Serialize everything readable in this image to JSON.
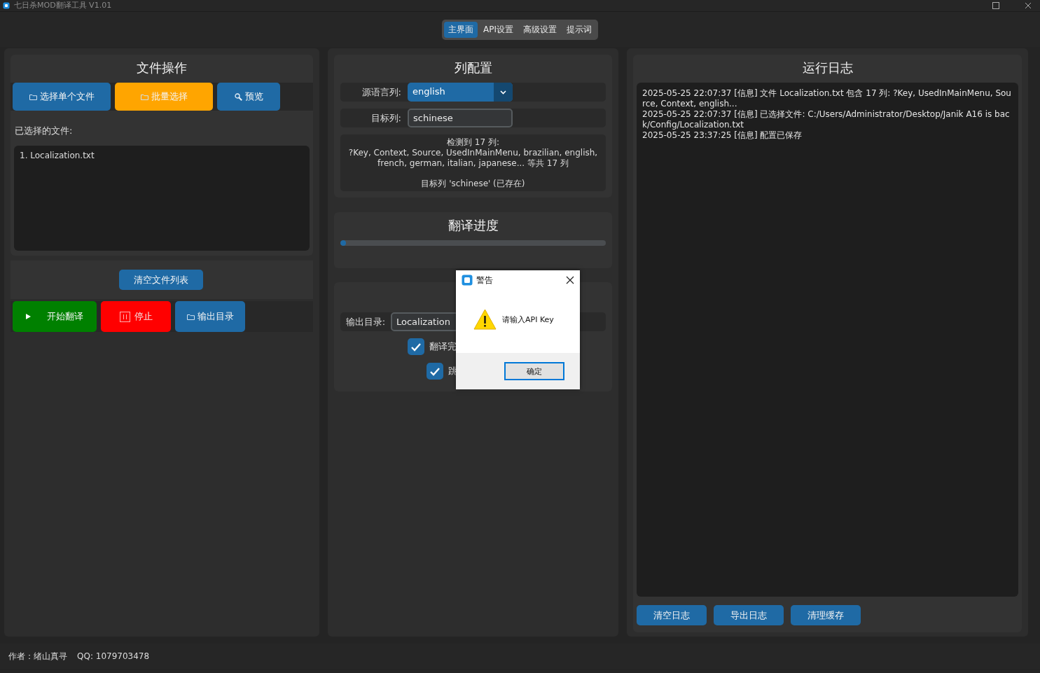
{
  "window": {
    "title": "七日杀MOD翻译工具 V1.01"
  },
  "tabs": [
    {
      "label": "主界面",
      "selected": true
    },
    {
      "label": "API设置",
      "selected": false
    },
    {
      "label": "高级设置",
      "selected": false
    },
    {
      "label": "提示词",
      "selected": false
    }
  ],
  "file_panel": {
    "title": "文件操作",
    "buttons": [
      {
        "label": "选择单个文件",
        "kind": "folder",
        "color": "#1f6aa5"
      },
      {
        "label": "批量选择",
        "kind": "folder",
        "color": "#ffa500"
      },
      {
        "label": "预览",
        "kind": "search",
        "color": "#1f6aa5"
      }
    ],
    "selected_label": "已选择的文件:",
    "files": [
      "1. Localization.txt"
    ],
    "clear_button": "清空文件列表",
    "actions": [
      {
        "label": "开始翻译",
        "kind": "play",
        "color": "#008000"
      },
      {
        "label": "停止",
        "kind": "pause",
        "color": "#ff0000"
      },
      {
        "label": "输出目录",
        "kind": "folder",
        "color": "#1f6aa5"
      }
    ]
  },
  "column_config": {
    "title": "列配置",
    "source": {
      "label": "源语言列:",
      "value": "english"
    },
    "target": {
      "label": "目标列:",
      "value": "schinese"
    },
    "detection": "检测到 17 列:\n?Key, Context, Source, UsedInMainMenu, brazilian, english,\nfrench, german, italian, japanese... 等共 17 列",
    "target_status": "目标列 'schinese' (已存在)"
  },
  "progress": {
    "title": "翻译进度",
    "level": 0.02
  },
  "output": {
    "dir_label": "输出目录:",
    "dir_value": "Localization",
    "options": [
      {
        "label": "翻译完",
        "checked": true
      },
      {
        "label": "跳",
        "checked": true
      }
    ]
  },
  "log": {
    "title": "运行日志",
    "entries": [
      "2025-05-25 22:07:37 [信息] 文件 Localization.txt 包含 17 列: ?Key, UsedInMainMenu, Source, Context, english...",
      "2025-05-25 22:07:37 [信息] 已选择文件: C:/Users/Administrator/Desktop/Janik A16 is back/Config/Localization.txt",
      "2025-05-25 23:37:25 [信息] 配置已保存"
    ],
    "buttons": [
      "清空日志",
      "导出日志",
      "清理缓存"
    ]
  },
  "status_bar": [
    "作者：绪山真寻",
    "QQ: 1079703478"
  ],
  "dialog": {
    "title": "警告",
    "message": "请输入API Key",
    "button": "确定"
  }
}
